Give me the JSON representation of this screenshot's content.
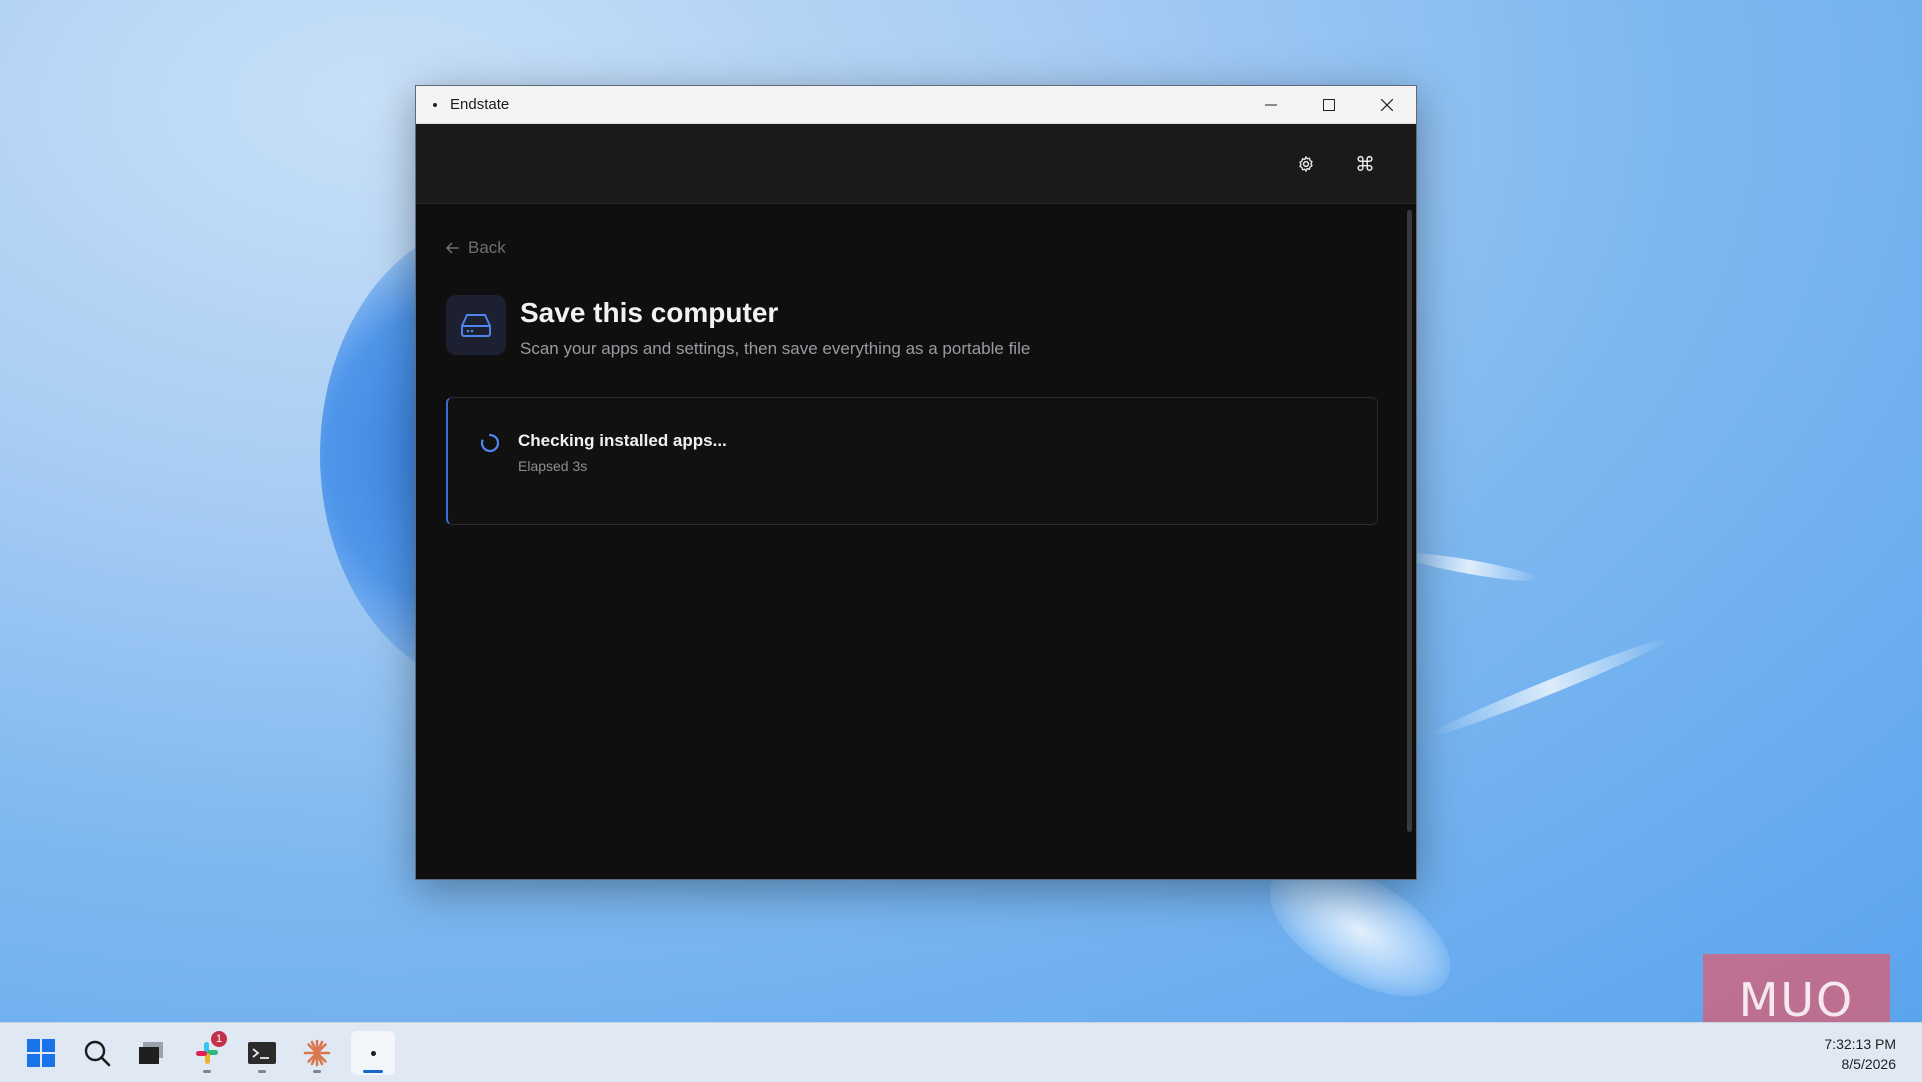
{
  "window": {
    "title": "Endstate",
    "controls": [
      "minimize",
      "maximize",
      "close"
    ]
  },
  "header": {
    "icons": [
      "gear-icon",
      "command-icon"
    ]
  },
  "page": {
    "back_label": "Back",
    "title": "Save this computer",
    "subtitle": "Scan your apps and settings, then save everything as a portable file"
  },
  "status": {
    "title": "Checking installed apps...",
    "elapsed": "Elapsed 3s"
  },
  "taskbar": {
    "apps": [
      "start",
      "search",
      "task-view",
      "slack",
      "terminal",
      "claude",
      "endstate"
    ],
    "slack_badge": "1",
    "time": "7:32:13 PM",
    "date": "8/5/2026"
  },
  "watermark": {
    "text": "MUO"
  },
  "colors": {
    "accent": "#3b6fd6",
    "window_bg": "#0f0f10",
    "header_bg": "#1a1a1b"
  }
}
